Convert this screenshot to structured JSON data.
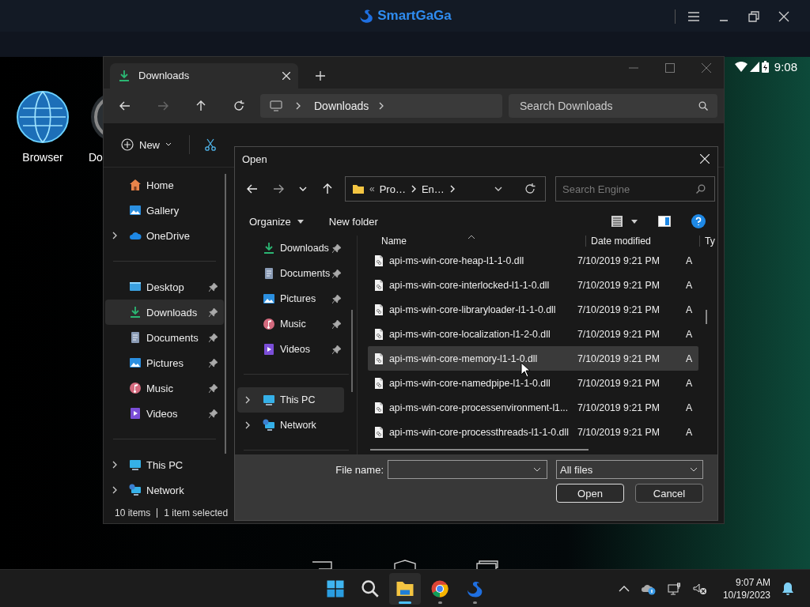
{
  "emulator": {
    "title": "SmartGaGa"
  },
  "android": {
    "time": "9:08",
    "apps": [
      {
        "label": "Browser",
        "kind": "globe"
      },
      {
        "label": "Do",
        "kind": "dial"
      }
    ]
  },
  "explorer": {
    "tab": {
      "title": "Downloads"
    },
    "address": "Downloads",
    "search": {
      "placeholder": "Search Downloads"
    },
    "new_label": "New",
    "sidebar": [
      {
        "items": [
          {
            "label": "Home",
            "kind": "home",
            "expandable": false,
            "pinned": false,
            "selected": false
          },
          {
            "label": "Gallery",
            "kind": "gallery",
            "expandable": false,
            "pinned": false,
            "selected": false
          },
          {
            "label": "OneDrive",
            "kind": "cloud",
            "expandable": true,
            "pinned": false,
            "selected": false
          }
        ]
      },
      {
        "items": [
          {
            "label": "Desktop",
            "kind": "desktop",
            "expandable": false,
            "pinned": true,
            "selected": false
          },
          {
            "label": "Downloads",
            "kind": "download",
            "expandable": false,
            "pinned": true,
            "selected": true
          },
          {
            "label": "Documents",
            "kind": "document",
            "expandable": false,
            "pinned": true,
            "selected": false
          },
          {
            "label": "Pictures",
            "kind": "picture",
            "expandable": false,
            "pinned": true,
            "selected": false
          },
          {
            "label": "Music",
            "kind": "music",
            "expandable": false,
            "pinned": true,
            "selected": false
          },
          {
            "label": "Videos",
            "kind": "video",
            "expandable": false,
            "pinned": true,
            "selected": false
          }
        ]
      },
      {
        "items": [
          {
            "label": "This PC",
            "kind": "pc",
            "expandable": true,
            "pinned": false,
            "selected": false
          },
          {
            "label": "Network",
            "kind": "network",
            "expandable": true,
            "pinned": false,
            "selected": false
          }
        ]
      }
    ],
    "status": {
      "count": "10 items",
      "selection": "1 item selected"
    }
  },
  "dialog": {
    "title": "Open",
    "path": {
      "overflow": "«",
      "parts": [
        "Pro…",
        "En…"
      ]
    },
    "search": {
      "placeholder": "Search Engine"
    },
    "organize": "Organize",
    "new_folder": "New folder",
    "nav": [
      {
        "label": "Downloads",
        "kind": "download",
        "expandable": false,
        "pinned": true,
        "selected": false
      },
      {
        "label": "Documents",
        "kind": "document",
        "expandable": false,
        "pinned": true,
        "selected": false
      },
      {
        "label": "Pictures",
        "kind": "picture",
        "expandable": false,
        "pinned": true,
        "selected": false
      },
      {
        "label": "Music",
        "kind": "music",
        "expandable": false,
        "pinned": true,
        "selected": false
      },
      {
        "label": "Videos",
        "kind": "video",
        "expandable": false,
        "pinned": true,
        "selected": false
      },
      {
        "label": "This PC",
        "kind": "pc",
        "expandable": true,
        "pinned": false,
        "selected": true
      },
      {
        "label": "Network",
        "kind": "network",
        "expandable": true,
        "pinned": false,
        "selected": false
      }
    ],
    "columns": [
      "Name",
      "Date modified",
      "Ty"
    ],
    "files": [
      {
        "name": "api-ms-win-core-heap-l1-1-0.dll",
        "date": "7/10/2019 9:21 PM",
        "type": "A",
        "selected": false
      },
      {
        "name": "api-ms-win-core-interlocked-l1-1-0.dll",
        "date": "7/10/2019 9:21 PM",
        "type": "A",
        "selected": false
      },
      {
        "name": "api-ms-win-core-libraryloader-l1-1-0.dll",
        "date": "7/10/2019 9:21 PM",
        "type": "A",
        "selected": false
      },
      {
        "name": "api-ms-win-core-localization-l1-2-0.dll",
        "date": "7/10/2019 9:21 PM",
        "type": "A",
        "selected": false
      },
      {
        "name": "api-ms-win-core-memory-l1-1-0.dll",
        "date": "7/10/2019 9:21 PM",
        "type": "A",
        "selected": true
      },
      {
        "name": "api-ms-win-core-namedpipe-l1-1-0.dll",
        "date": "7/10/2019 9:21 PM",
        "type": "A",
        "selected": false
      },
      {
        "name": "api-ms-win-core-processenvironment-l1...",
        "date": "7/10/2019 9:21 PM",
        "type": "A",
        "selected": false
      },
      {
        "name": "api-ms-win-core-processthreads-l1-1-0.dll",
        "date": "7/10/2019 9:21 PM",
        "type": "A",
        "selected": false
      }
    ],
    "file_name_label": "File name:",
    "filter": "All files",
    "buttons": [
      "Open",
      "Cancel"
    ]
  },
  "taskbar": {
    "apps": [
      {
        "kind": "start",
        "running": false,
        "active": false
      },
      {
        "kind": "search",
        "running": false,
        "active": false
      },
      {
        "kind": "explorer",
        "running": true,
        "active": true
      },
      {
        "kind": "chrome",
        "running": true,
        "active": false
      },
      {
        "kind": "swan",
        "running": true,
        "active": false
      }
    ],
    "time": "9:07 AM",
    "date": "10/19/2023"
  }
}
